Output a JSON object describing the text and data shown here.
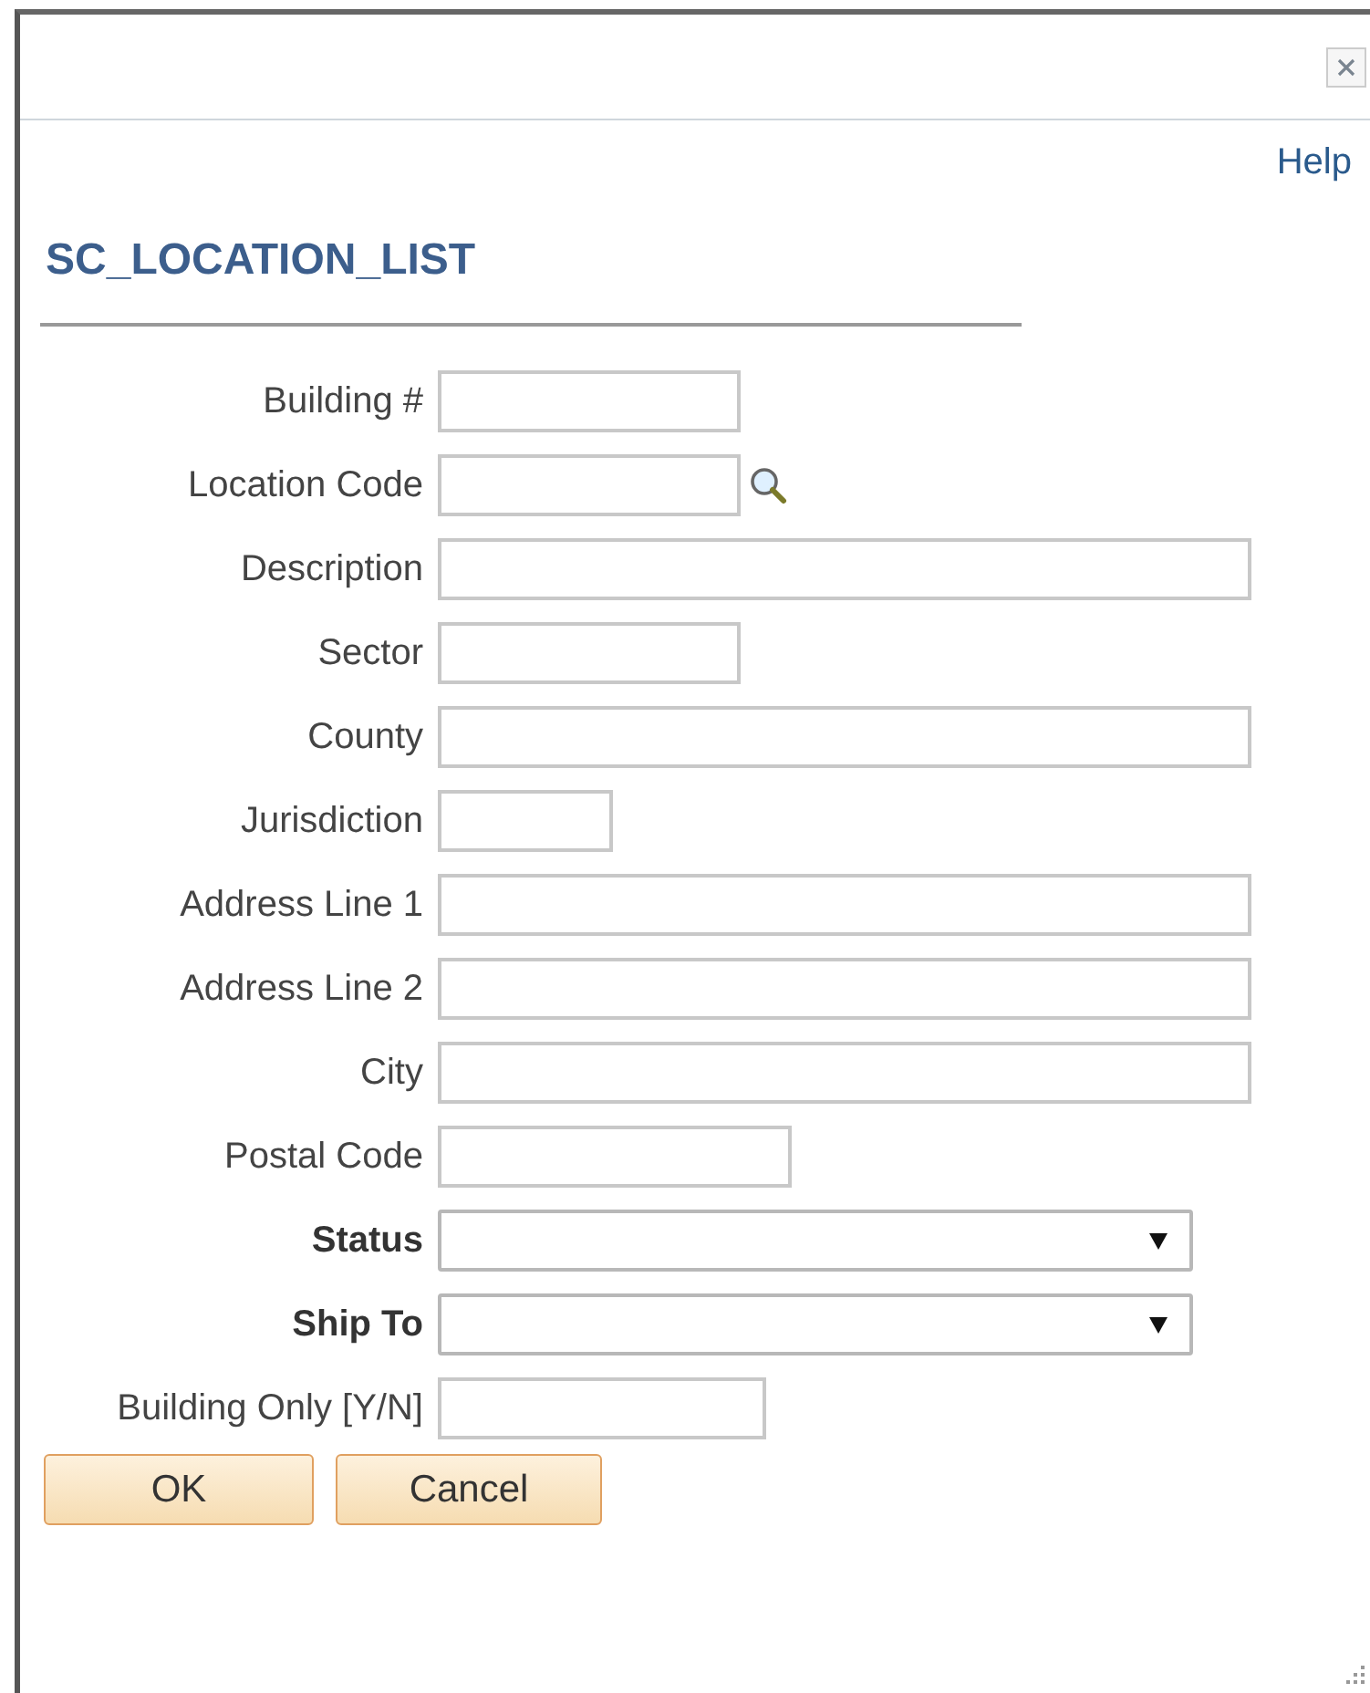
{
  "dialog": {
    "help_link": "Help",
    "title": "SC_LOCATION_LIST"
  },
  "fields": [
    {
      "label": "Building #",
      "kind": "text",
      "required": false
    },
    {
      "label": "Location Code",
      "kind": "lookup",
      "required": false
    },
    {
      "label": "Description",
      "kind": "text",
      "required": false
    },
    {
      "label": "Sector",
      "kind": "text",
      "required": false
    },
    {
      "label": "County",
      "kind": "text",
      "required": false
    },
    {
      "label": "Jurisdiction",
      "kind": "text",
      "required": false
    },
    {
      "label": "Address Line 1",
      "kind": "text",
      "required": false
    },
    {
      "label": "Address Line 2",
      "kind": "text",
      "required": false
    },
    {
      "label": "City",
      "kind": "text",
      "required": false
    },
    {
      "label": "Postal Code",
      "kind": "text",
      "required": false
    },
    {
      "label": "Status",
      "kind": "select",
      "required": true
    },
    {
      "label": "Ship To",
      "kind": "select",
      "required": true
    },
    {
      "label": "Building Only [Y/N]",
      "kind": "text",
      "required": false
    }
  ],
  "buttons": [
    "OK",
    "Cancel"
  ]
}
